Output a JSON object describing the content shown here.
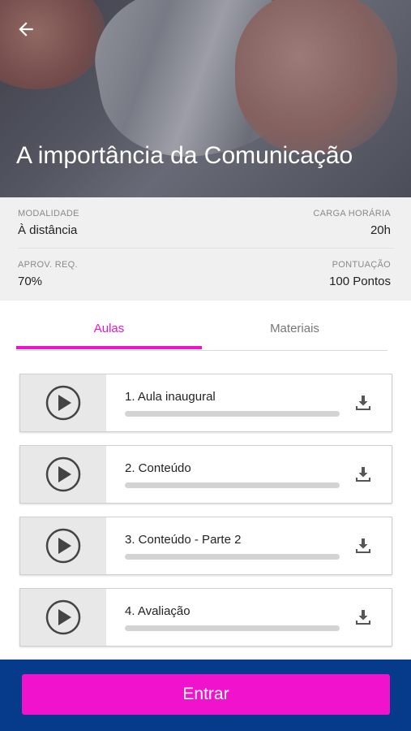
{
  "header": {
    "back_icon": "arrow-left-icon",
    "title": "A importância da Comunicação"
  },
  "info": {
    "modalidade_label": "MODALIDADE",
    "modalidade_value": "À distância",
    "carga_label": "CARGA HORÁRIA",
    "carga_value": "20h",
    "aprov_label": "APROV. REQ.",
    "aprov_value": "70%",
    "pontuacao_label": "PONTUAÇÃO",
    "pontuacao_value": "100 Pontos"
  },
  "tabs": [
    {
      "label": "Aulas",
      "active": true
    },
    {
      "label": "Materiais",
      "active": false
    }
  ],
  "lessons": [
    {
      "title": "1. Aula inaugural",
      "progress": 0
    },
    {
      "title": "2. Conteúdo",
      "progress": 0
    },
    {
      "title": "3. Conteúdo - Parte 2",
      "progress": 0
    },
    {
      "title": "4. Avaliação",
      "progress": 0
    }
  ],
  "footer": {
    "enter_label": "Entrar"
  },
  "colors": {
    "accent": "#ec15c9",
    "footer_bg": "#063a8a",
    "button_bg": "#f112cd"
  }
}
